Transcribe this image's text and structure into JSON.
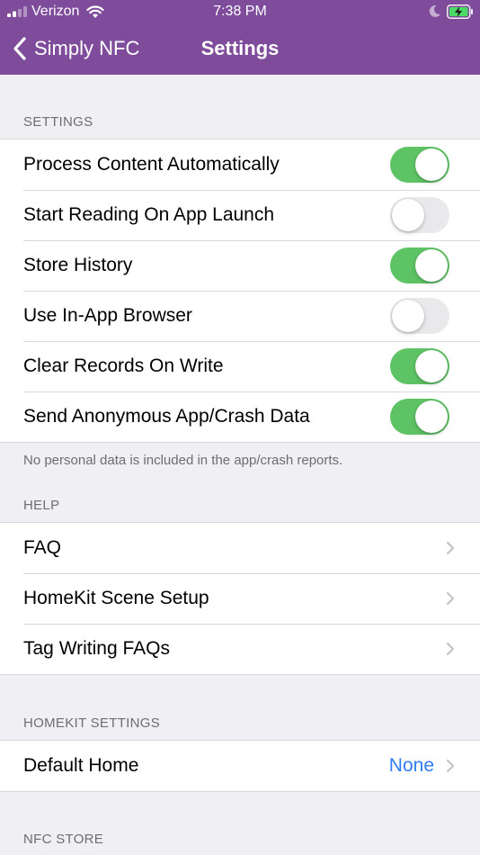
{
  "status_bar": {
    "carrier": "Verizon",
    "time": "7:38 PM",
    "icons": [
      "signal-icon",
      "wifi-icon",
      "moon-icon",
      "battery-charging-icon"
    ]
  },
  "nav": {
    "back_label": "Simply NFC",
    "title": "Settings"
  },
  "sections": {
    "settings": {
      "header": "SETTINGS",
      "items": [
        {
          "label": "Process Content Automatically",
          "on": true
        },
        {
          "label": "Start Reading On App Launch",
          "on": false
        },
        {
          "label": "Store History",
          "on": true
        },
        {
          "label": "Use In-App Browser",
          "on": false
        },
        {
          "label": "Clear Records On Write",
          "on": true
        },
        {
          "label": "Send Anonymous App/Crash Data",
          "on": true
        }
      ],
      "footer": "No personal data is included in the app/crash reports."
    },
    "help": {
      "header": "HELP",
      "items": [
        {
          "label": "FAQ"
        },
        {
          "label": "HomeKit Scene Setup"
        },
        {
          "label": "Tag Writing FAQs"
        }
      ]
    },
    "homekit": {
      "header": "HOMEKIT SETTINGS",
      "items": [
        {
          "label": "Default Home",
          "value": "None"
        }
      ]
    },
    "nfc_store": {
      "header": "NFC STORE"
    }
  },
  "colors": {
    "header_bg": "#7e4c9b",
    "toggle_on": "#5ec364",
    "toggle_off": "#e9e9eb",
    "link_blue": "#2f7cf6",
    "page_bg": "#efeff4"
  }
}
